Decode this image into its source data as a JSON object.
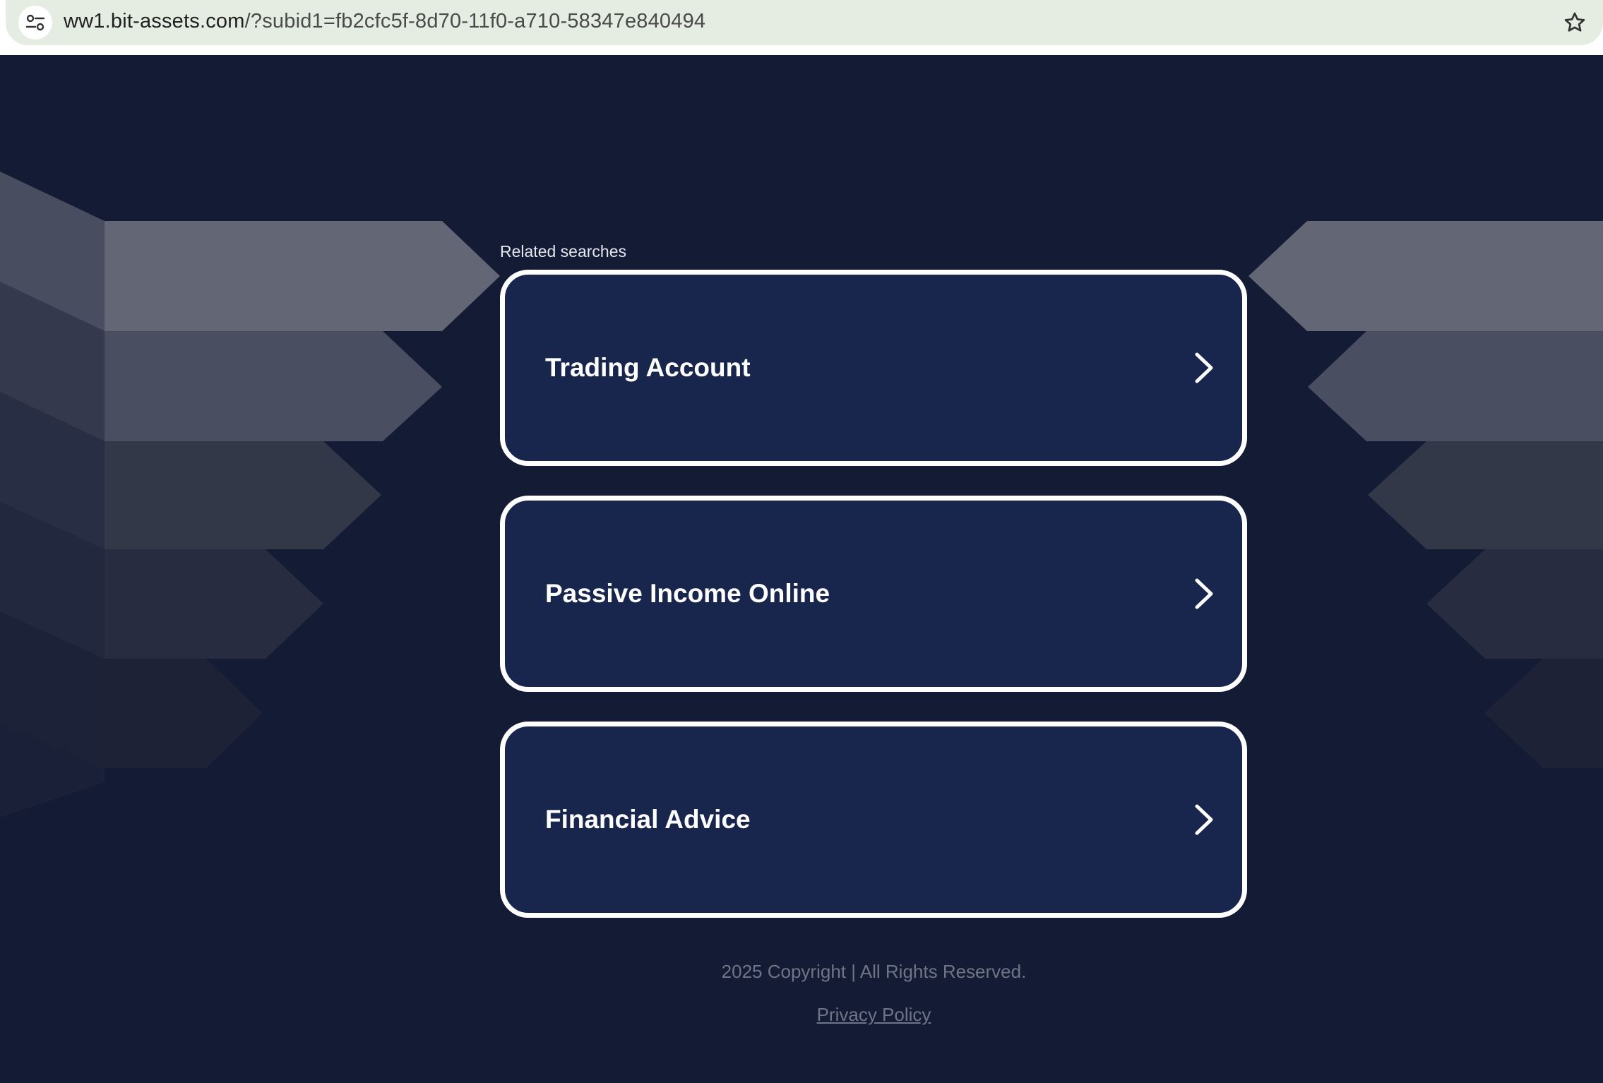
{
  "browser": {
    "url_host": "ww1.bit-assets.com",
    "url_path": "/?subid1=fb2cfc5f-8d70-11f0-a710-58347e840494",
    "site_info_icon": "tune-icon",
    "bookmark_icon": "star-icon"
  },
  "main": {
    "related_label": "Related searches",
    "cards": [
      {
        "label": "Trading Account",
        "icon": "chevron-right-icon"
      },
      {
        "label": "Passive Income Online",
        "icon": "chevron-right-icon"
      },
      {
        "label": "Financial Advice",
        "icon": "chevron-right-icon"
      }
    ]
  },
  "footer": {
    "copyright": "2025 Copyright | All Rights Reserved.",
    "privacy": "Privacy Policy"
  },
  "colors": {
    "page_background": "#141b35",
    "card_background": "#18264d",
    "card_border": "#ffffff",
    "footer_text": "#6f7486"
  }
}
